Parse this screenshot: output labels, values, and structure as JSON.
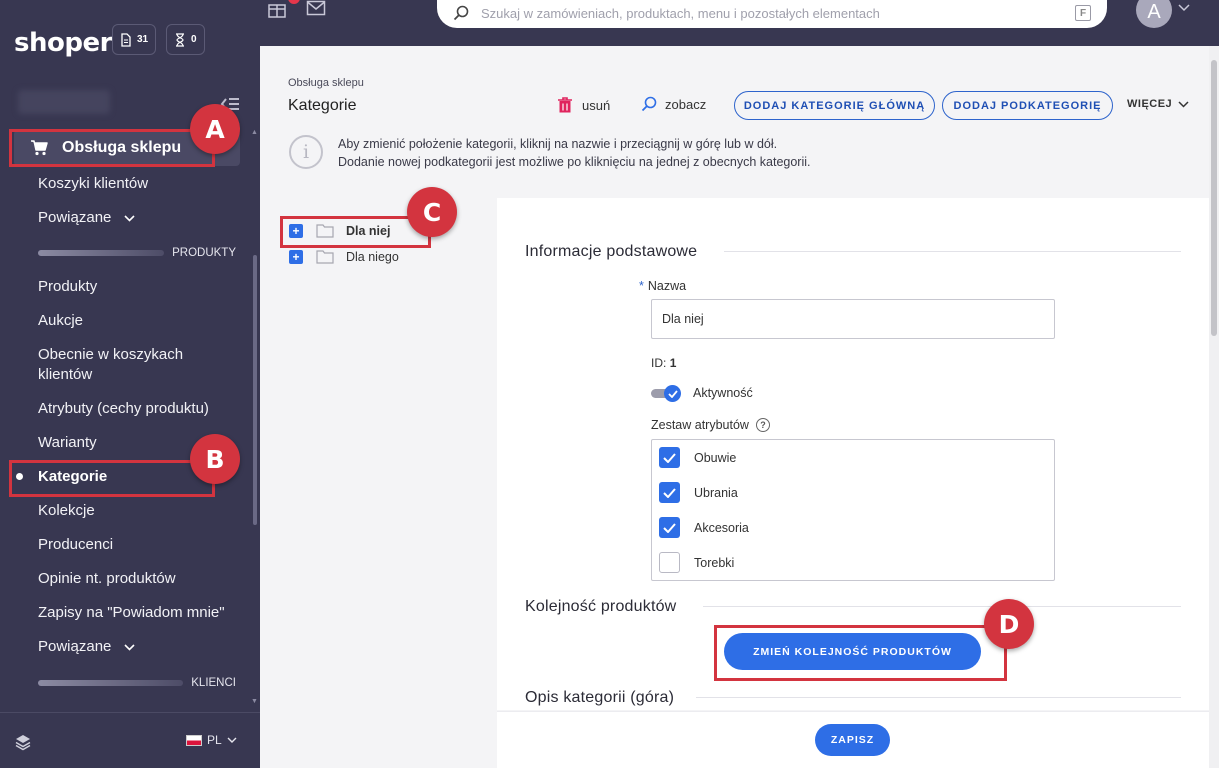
{
  "header": {
    "logo": "shoper",
    "orders_count": "31",
    "pending_count": "0",
    "search_placeholder": "Szukaj w zamówieniach, produktach, menu i pozostałych elementach",
    "search_shortcut": "F",
    "avatar_letter": "A"
  },
  "sidebar": {
    "active_group": "Obsługa sklepu",
    "items": {
      "carts": "Koszyki klientów",
      "related1": "Powiązane",
      "section_products": "PRODUKTY",
      "products": "Produkty",
      "auctions": "Aukcje",
      "in_carts_line1": "Obecnie w koszykach",
      "in_carts_line2": "klientów",
      "attributes": "Atrybuty (cechy produktu)",
      "variants": "Warianty",
      "categories": "Kategorie",
      "collections": "Kolekcje",
      "producers": "Producenci",
      "reviews": "Opinie nt. produktów",
      "notify": "Zapisy na \"Powiadom mnie\"",
      "related2": "Powiązane",
      "section_clients": "KLIENCI"
    },
    "language": "PL"
  },
  "main": {
    "breadcrumb": "Obsługa sklepu",
    "title": "Kategorie",
    "actions": {
      "delete": "usuń",
      "view": "zobacz",
      "add_main": "DODAJ KATEGORIĘ GŁÓWNĄ",
      "add_sub": "DODAJ PODKATEGORIĘ",
      "more": "WIĘCEJ"
    },
    "info_line1": "Aby zmienić położenie kategorii, kliknij na nazwie i przeciągnij w górę lub w dół.",
    "info_line2": "Dodanie nowej podkategorii jest możliwe po kliknięciu na jednej z obecnych kategorii.",
    "tree": [
      "Dla niej",
      "Dla niego"
    ],
    "form": {
      "section_basic": "Informacje podstawowe",
      "name_required": "*",
      "name_label": "Nazwa",
      "name_value": "Dla niej",
      "id_label": "ID:",
      "id_value": "1",
      "active_label": "Aktywność",
      "attr_set_label": "Zestaw atrybutów",
      "attr_options": [
        {
          "label": "Obuwie",
          "checked": true
        },
        {
          "label": "Ubrania",
          "checked": true
        },
        {
          "label": "Akcesoria",
          "checked": true
        },
        {
          "label": "Torebki",
          "checked": false
        }
      ],
      "section_order": "Kolejność produktów",
      "change_order_button": "ZMIEŃ KOLEJNOŚĆ PRODUKTÓW",
      "section_desc": "Opis kategorii (góra)",
      "save_button": "ZAPISZ"
    }
  },
  "annotations": [
    "A",
    "B",
    "C",
    "D"
  ],
  "colors": {
    "sidebar_bg": "#383751",
    "accent_blue": "#2e6ee6",
    "highlight_red": "#d3343f"
  }
}
